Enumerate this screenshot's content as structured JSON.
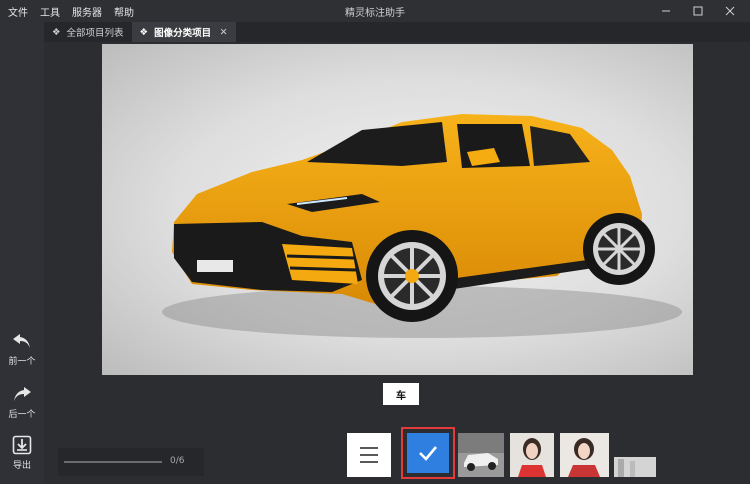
{
  "menu": [
    "文件",
    "工具",
    "服务器",
    "帮助"
  ],
  "app_title": "精灵标注助手",
  "tabs": [
    {
      "label": "全部项目列表",
      "active": false
    },
    {
      "label": "图像分类项目",
      "active": true
    }
  ],
  "tab_close": "✕",
  "left_toolbar": {
    "prev_label": "前一个",
    "next_label": "后一个",
    "export_label": "导出"
  },
  "class_tag": "车",
  "progress": {
    "text": "0/6",
    "fraction": 0
  },
  "colors": {
    "accent": "#2f7fe0",
    "selected_border": "#e23b3b",
    "car_body": "#f3a90f"
  }
}
